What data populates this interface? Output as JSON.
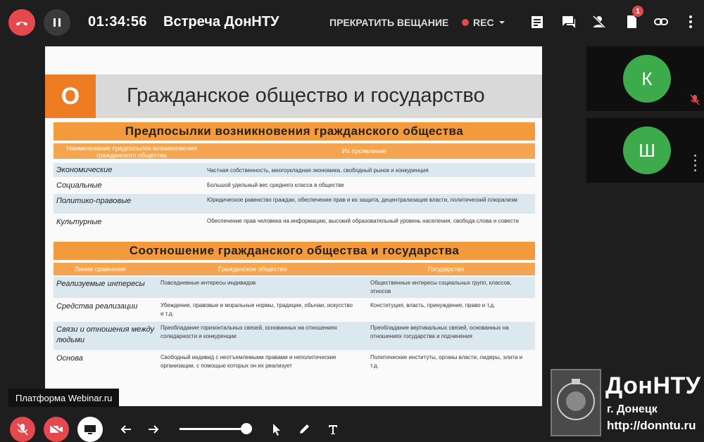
{
  "topbar": {
    "timer": "01:34:56",
    "title": "Встреча ДонНТУ",
    "stop_broadcast": "ПРЕКРАТИТЬ ВЕЩАНИЕ",
    "rec": "REC",
    "badge_count": "1"
  },
  "slide": {
    "letter": "O",
    "title": "Гражданское общество и государство",
    "section1": {
      "heading": "Предпосылки возникновения гражданского общества",
      "col1": "Наименование предпосылок возникновения гражданского общества",
      "col2": "Их проявление",
      "rows": [
        {
          "name": "Экономические",
          "text": "Частная собственность, многоукладная экономика, свободный рынок и конкуренция"
        },
        {
          "name": "Социальные",
          "text": "Большой удельный вес среднего класса в обществе"
        },
        {
          "name": "Политико-правовые",
          "text": "Юридическое равенство граждан, обеспечение прав и их защита, децентрализация власти, политический плюрализм"
        },
        {
          "name": "Культурные",
          "text": "Обеспечение прав человека на информацию, высокий образовательный уровень населения, свобода слова и совести"
        }
      ]
    },
    "section2": {
      "heading": "Соотношение гражданского общества и государства",
      "col1": "Линии сравнения",
      "col2": "Гражданское общество",
      "col3": "Государство",
      "rows": [
        {
          "name": "Реализуемые интересы",
          "civil": "Повседневные интересы индивидов",
          "state": "Общественные интересы социальных групп, классов, этносов"
        },
        {
          "name": "Средства реализации",
          "civil": "Убеждение, правовые и моральные нормы, традиции, обычаи, искусство и т.д.",
          "state": "Конституция, власть, принуждение, право и т.д."
        },
        {
          "name": "Связи и отношения между людьми",
          "civil": "Преобладание горизонтальных связей, основанных на отношениях солидарности и конкуренции",
          "state": "Преобладание вертикальных связей, основанных на отношениях государства и подчинения"
        },
        {
          "name": "Основа",
          "civil": "Свободный индивид с неотъемлемыми правами и неполитические организации, с помощью которых он их реализует",
          "state": "Политические институты, органы власти, лидеры, элита и т.д."
        }
      ]
    }
  },
  "participants": [
    {
      "initial": "К"
    },
    {
      "initial": "Ш"
    }
  ],
  "platform_label": "Платформа Webinar.ru",
  "logo": {
    "name": "ДонНТУ",
    "city": "г. Донецк",
    "url": "http://donntu.ru"
  },
  "colors": {
    "accent_red": "#e5484d",
    "avatar_green": "#3daa4b",
    "slide_orange": "#ee7c22"
  },
  "icons": [
    "phone-end-icon",
    "pause-icon",
    "chevron-down-icon",
    "notes-icon",
    "chat-icon",
    "participants-icon",
    "document-icon",
    "link-icon",
    "more-icon",
    "mic-off-icon",
    "camera-off-icon",
    "screen-share-icon",
    "arrow-left-icon",
    "arrow-right-icon",
    "pointer-icon",
    "pen-icon",
    "text-icon"
  ]
}
